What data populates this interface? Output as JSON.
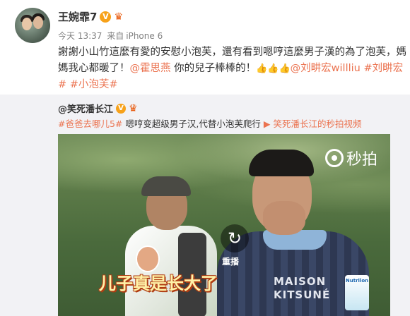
{
  "post": {
    "author": "王婉霏7",
    "verified_badge": "V",
    "time": "今天 13:37",
    "source_prefix": "来自",
    "source": "iPhone 6",
    "text_parts": [
      "謝謝小山竹這麼有愛的安慰小泡芙，還有看到嗯哼這麼男子漢的為了泡芙，媽媽我心都暖了！",
      "@霍思燕",
      " 你的兒子棒棒的！",
      "👍👍👍",
      "@刘畊宏willliu",
      " ",
      "#刘畊宏#",
      " ",
      "#小泡芙#"
    ]
  },
  "repost": {
    "author": "@笑死潘长江",
    "verified_badge": "V",
    "topic1": "#爸爸去哪儿5#",
    "text": "嗯哼变超级男子汉,代替小泡芙爬行",
    "video_icon": "video-icon",
    "video_source": "笑死潘长江的秒拍视频"
  },
  "video": {
    "watermark": "秒拍",
    "replay_label": "重播",
    "subtitle": "儿子真是长大了",
    "shirt_text": "MAISON\nKITSUNÉ",
    "product_label": "Nutrilon"
  },
  "colors": {
    "link": "#eb7350",
    "badge": "#f7a21a",
    "repost_bg": "#f2f2f5"
  }
}
